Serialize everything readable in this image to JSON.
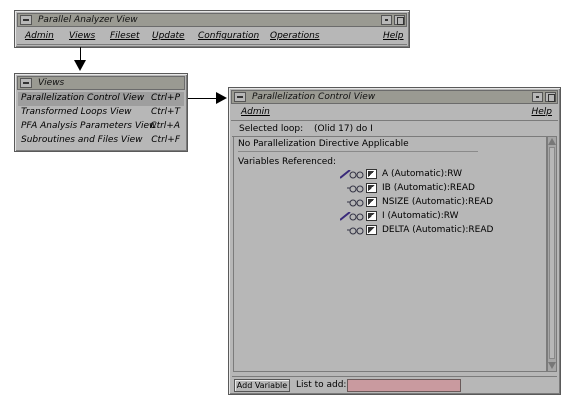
{
  "main_window": {
    "title": "Parallel Analyzer View",
    "menus": [
      "Admin",
      "Views",
      "Fileset",
      "Update",
      "Configuration",
      "Operations"
    ],
    "help": "Help"
  },
  "views_menu": {
    "title": "Views",
    "items": [
      {
        "label": "Parallelization Control View",
        "accel": "Ctrl+P"
      },
      {
        "label": "Transformed Loops View",
        "accel": "Ctrl+T"
      },
      {
        "label": "PFA Analysis Parameters View",
        "accel": "Ctrl+A"
      },
      {
        "label": "Subroutines and Files View",
        "accel": "Ctrl+F"
      }
    ]
  },
  "pcv_window": {
    "title": "Parallelization Control View",
    "menu_admin": "Admin",
    "menu_help": "Help",
    "selected_loop_label": "Selected loop:",
    "selected_loop_value": "(Olid 17) do I",
    "status_text": "No Parallelization Directive Applicable",
    "vars_heading": "Variables Referenced:",
    "variables": [
      {
        "label": "A (Automatic):RW",
        "icon": "pencil-glasses-icon"
      },
      {
        "label": "IB (Automatic):READ",
        "icon": "glasses-icon"
      },
      {
        "label": "NSIZE (Automatic):READ",
        "icon": "glasses-icon"
      },
      {
        "label": "I (Automatic):RW",
        "icon": "pencil-glasses-icon"
      },
      {
        "label": "DELTA (Automatic):READ",
        "icon": "glasses-icon"
      }
    ],
    "add_variable_button": "Add Variable",
    "list_to_add_label": "List to add:",
    "list_to_add_value": ""
  },
  "colors": {
    "window_bg": "#b7b7b7",
    "titlebar_bg": "#9a9a92",
    "input_field": "#c99a9f",
    "pencil": "#3a2a7a"
  }
}
